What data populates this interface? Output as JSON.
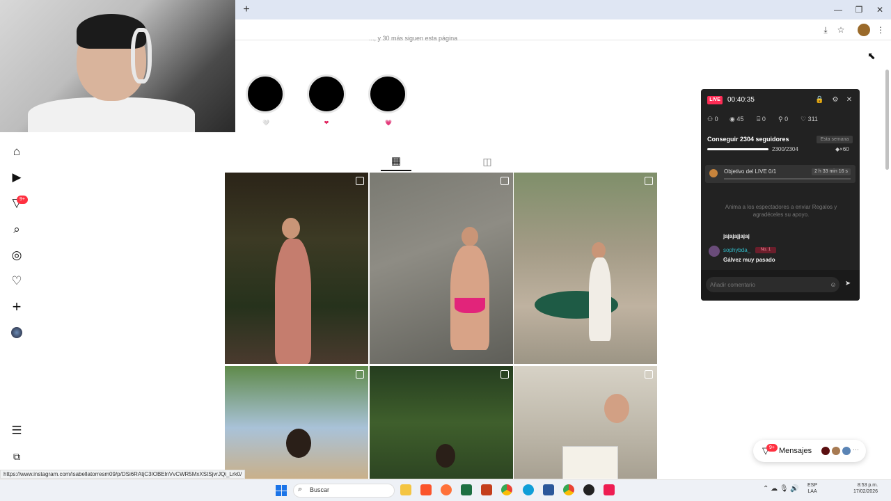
{
  "browser": {
    "new_tab": "+",
    "minimize": "—",
    "maximize": "❐",
    "close": "✕",
    "toolbar_icons": [
      "install-icon",
      "star-icon",
      "profile-icon",
      "menu-icon"
    ]
  },
  "profile": {
    "followed_by_text": "..., y 30 más siguen esta página",
    "stories": [
      {
        "dot": "🤍"
      },
      {
        "dot": "❤"
      },
      {
        "dot": "💗"
      }
    ],
    "tabs": {
      "grid": "▦",
      "tagged": "◫"
    }
  },
  "nav": {
    "notifications_badge": "9+"
  },
  "live_panel": {
    "badge": "LIVE",
    "timer": "00:40:35",
    "stats": {
      "users": "0",
      "views": "45",
      "gifts": "0",
      "shares": "0",
      "likes": "311"
    },
    "goal_title": "Conseguir 2304 seguidores",
    "goal_period": "Esta semana",
    "goal_count": "2300/2304",
    "goal_progress": 0.998,
    "goal_multiplier": "×60",
    "objective_label": "Objetivo del LIVE 0/1",
    "objective_time": "2 h 33 min 16 s",
    "encourage_text": "Anima a los espectadores a enviar Regalos y agradéceles su apoyo.",
    "comments": [
      {
        "user": "",
        "text": "jajajajjajaj"
      },
      {
        "user": "sophybda_",
        "badge": "No. 1",
        "text": "Gálvez muy pasado"
      }
    ],
    "comment_placeholder": "Añadir comentario"
  },
  "messages": {
    "label": "Mensajes",
    "badge": "9+",
    "more": "···"
  },
  "status_url": "https://www.instagram.com/isabellatorresm09/p/DSi6RAtjC3IOBElnVvCWR5MxXStSjvrJQi_Lrk0/",
  "taskbar": {
    "search_label": "Buscar",
    "lang_line1": "ESP",
    "lang_line2": "LAA",
    "time": "8:53 p.m.",
    "date": "17/02/2026",
    "tray": "⌃  ☁  🎙  🔊"
  },
  "colors": {
    "live_red": "#fe2c55",
    "instagram_badge": "#ff3040",
    "panel_bg": "#222222"
  }
}
